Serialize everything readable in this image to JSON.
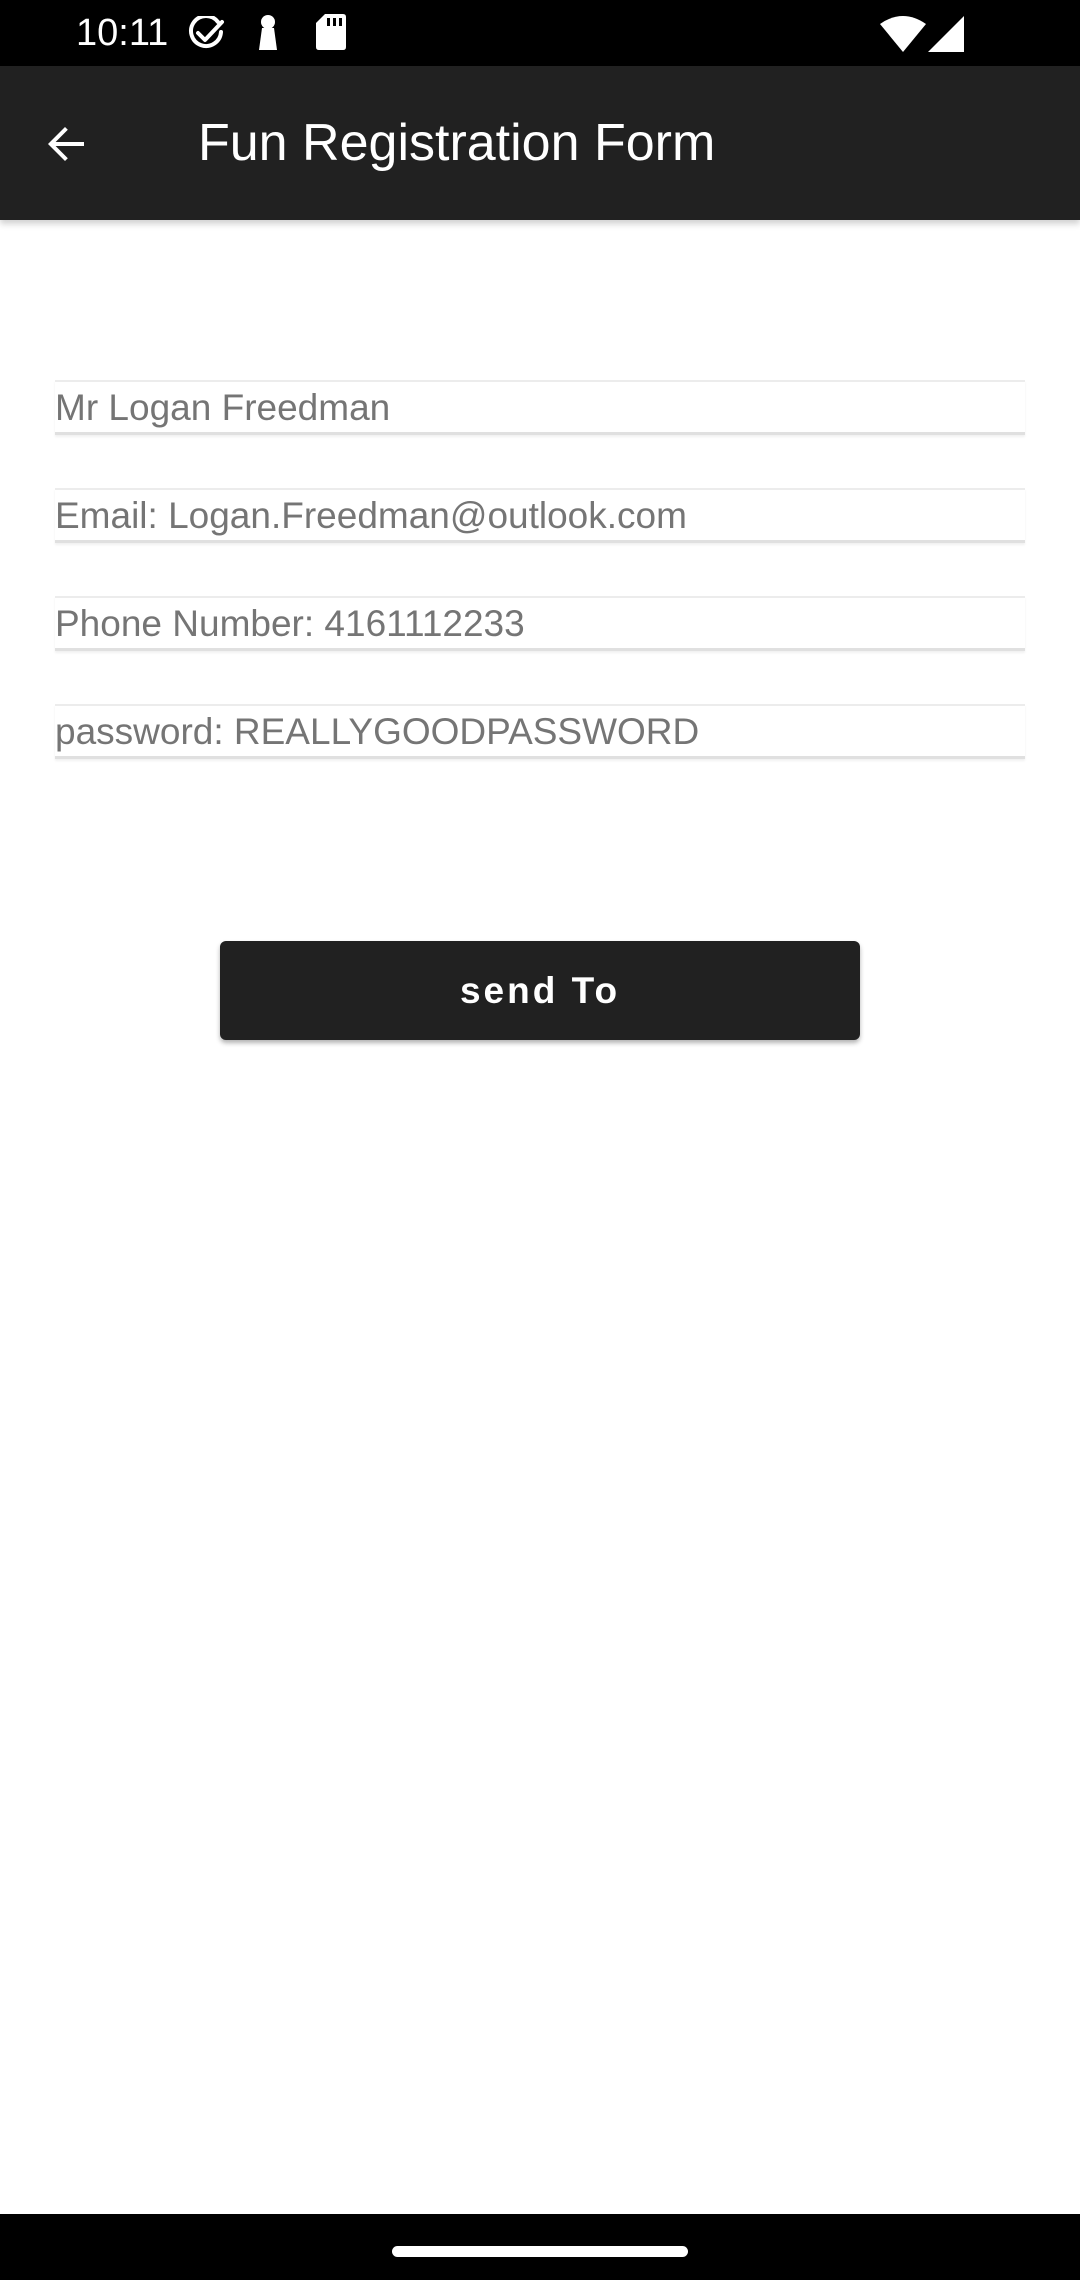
{
  "status_bar": {
    "time": "10:11",
    "left_icons": [
      "check-circle-icon",
      "keyhole-icon",
      "sd-card-icon"
    ],
    "right_icons": [
      "wifi-icon",
      "cell-signal-icon"
    ]
  },
  "app_bar": {
    "title": "Fun Registration Form",
    "back_icon": "arrow-back-icon"
  },
  "form": {
    "name_text": "Mr Logan Freedman",
    "email_text": "Email: Logan.Freedman@outlook.com",
    "phone_text": "Phone Number: 4161112233",
    "password_text": "password: REALLYGOODPASSWORD"
  },
  "send_button": {
    "label": "send To"
  },
  "colors": {
    "app_bar": "#212121",
    "status_bar": "#000000",
    "button": "#212121",
    "field_text": "#757575"
  }
}
